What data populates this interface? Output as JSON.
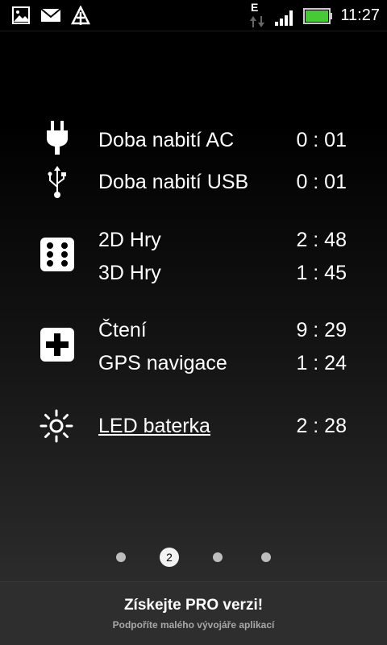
{
  "status_bar": {
    "time": "11:27",
    "network_type": "E",
    "battery_color": "#48c936",
    "left_icons": [
      "image-icon",
      "mail-icon",
      "upload-tree-icon"
    ]
  },
  "items": [
    {
      "label": "Doba nabití AC",
      "value": "0 : 01",
      "icon": "plug-icon"
    },
    {
      "label": "Doba nabití USB",
      "value": "0 : 01",
      "icon": "usb-icon"
    },
    {
      "label": "2D Hry",
      "value": "2 : 48",
      "icon": "dice-icon"
    },
    {
      "label": "3D Hry",
      "value": "1 : 45"
    },
    {
      "label": "Čtení",
      "value": "9 : 29",
      "icon": "plus-icon"
    },
    {
      "label": "GPS navigace",
      "value": "1 : 24"
    },
    {
      "label": "LED baterka",
      "value": "2 : 28",
      "icon": "sun-icon"
    }
  ],
  "pager": {
    "current_page": "2",
    "total_pages": 4
  },
  "promo": {
    "title": "Získejte PRO verzi!",
    "subtitle": "Podpoříte malého vývojáře aplikací"
  }
}
